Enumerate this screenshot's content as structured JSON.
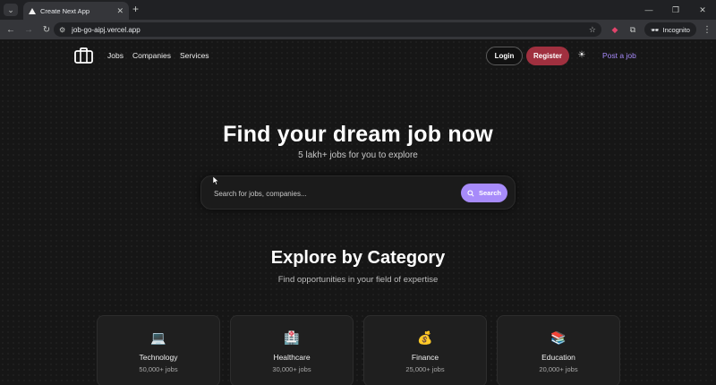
{
  "browser": {
    "tab_title": "Create Next App",
    "url": "job-go-aipj.vercel.app",
    "incognito_label": "Incognito"
  },
  "nav": {
    "links": [
      "Jobs",
      "Companies",
      "Services"
    ],
    "login_label": "Login",
    "register_label": "Register",
    "post_job_label": "Post a job"
  },
  "hero": {
    "title": "Find your dream job now",
    "subtitle": "5 lakh+ jobs for you to explore",
    "search_placeholder": "Search for jobs, companies...",
    "search_button": "Search"
  },
  "categories": {
    "title": "Explore by Category",
    "subtitle": "Find opportunities in your field of expertise",
    "items": [
      {
        "icon": "💻",
        "icon_name": "laptop-icon",
        "name": "Technology",
        "count": "50,000+ jobs"
      },
      {
        "icon": "🏥",
        "icon_name": "hospital-icon",
        "name": "Healthcare",
        "count": "30,000+ jobs"
      },
      {
        "icon": "💰",
        "icon_name": "money-bag-icon",
        "name": "Finance",
        "count": "25,000+ jobs"
      },
      {
        "icon": "📚",
        "icon_name": "books-icon",
        "name": "Education",
        "count": "20,000+ jobs"
      }
    ]
  },
  "colors": {
    "accent": "#a78bfa",
    "register": "#a0303f",
    "background": "#161616"
  }
}
